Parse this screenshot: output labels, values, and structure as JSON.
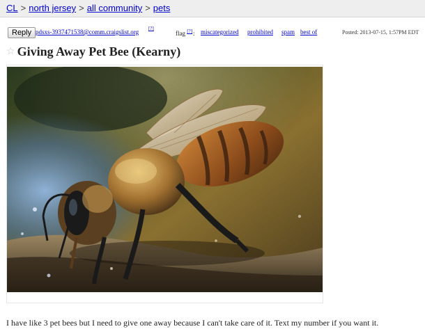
{
  "breadcrumb": {
    "items": [
      {
        "label": "CL"
      },
      {
        "label": "north jersey"
      },
      {
        "label": "all community"
      },
      {
        "label": "pets"
      }
    ],
    "separator": ">"
  },
  "reply": {
    "label": "Reply"
  },
  "contact": {
    "email": "pdsxs-3937471538@comm.craigslist.org",
    "help_marker": "[?]"
  },
  "flag": {
    "label": "flag",
    "help_marker": "[?]",
    "colon": ":",
    "options": [
      "miscategorized",
      "prohibited",
      "spam",
      "best of"
    ]
  },
  "posted": {
    "text": "Posted: 2013-07-15, 1:57PM EDT"
  },
  "post": {
    "title": "Giving Away Pet Bee (Kearny)",
    "body": "I have like 3 pet bees but I need to give one away because I can't take care of it. Text my number if you want it."
  },
  "photo": {
    "subject": "honeybee drinking water on a stone"
  },
  "icons": {
    "favorite": "star-icon"
  }
}
